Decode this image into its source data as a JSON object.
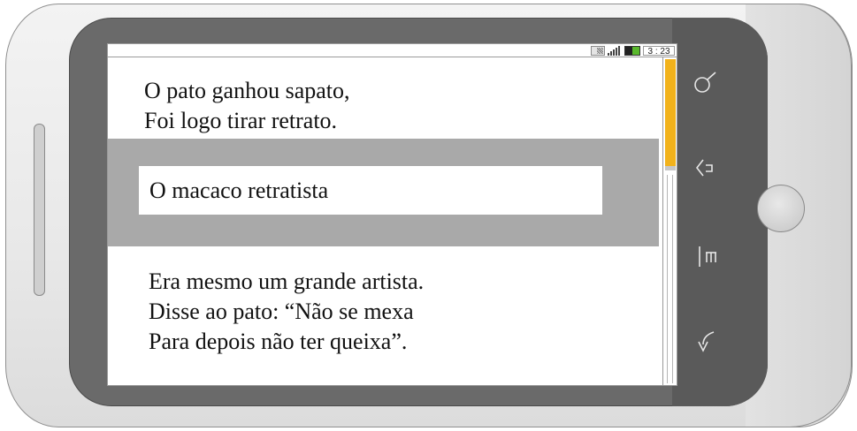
{
  "status_bar": {
    "sim_icon": "sim-card-icon",
    "signal_icon": "signal-bars-icon",
    "battery_icon": "battery-icon",
    "clock": "3 : 23"
  },
  "content": {
    "verse_top": [
      "O pato ganhou sapato,",
      "Foi logo tirar retrato."
    ],
    "highlighted_title": "O macaco retratista",
    "verse_bottom": [
      "Era mesmo um grande artista.",
      "Disse ao pato: “Não se mexa",
      "Para depois não ter queixa”."
    ]
  },
  "hardware_keys": {
    "search": "search-icon",
    "back": "back-icon",
    "menu": "menu-icon",
    "rotate": "rotate-icon",
    "home": "home-button"
  },
  "colors": {
    "scroll_thumb": "#f2b21b",
    "highlight_band": "#a9a9a9",
    "bezel": "#6a6a6a",
    "battery_green": "#59b82c"
  }
}
